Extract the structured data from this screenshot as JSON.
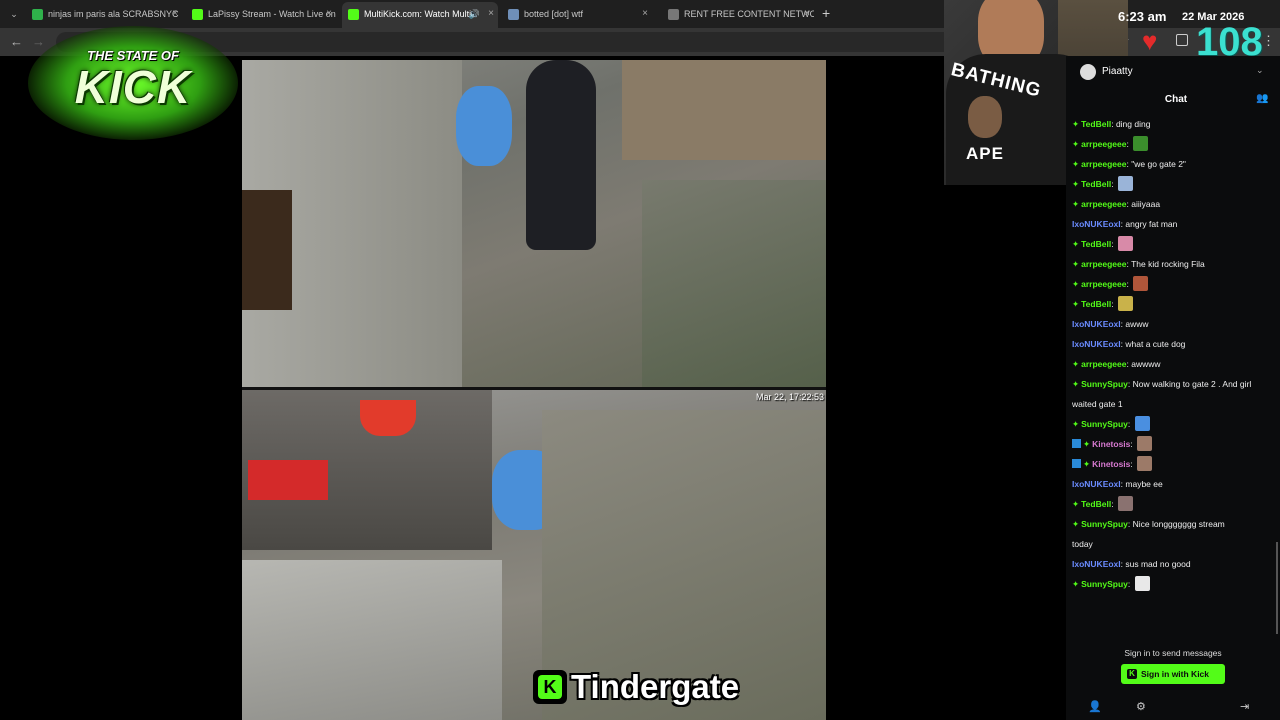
{
  "browser": {
    "tabs": [
      {
        "label": "ninjas im paris ala SCRABSNYC",
        "favicon": "play-icon",
        "active": false
      },
      {
        "label": "LaPissy Stream - Watch Live on",
        "favicon": "kick-icon",
        "active": false
      },
      {
        "label": "MultiKick.com: Watch Multi",
        "favicon": "multikick-icon",
        "active": true
      },
      {
        "label": "botted [dot] wtf",
        "favicon": "globe-icon",
        "active": false
      },
      {
        "label": "RENT FREE CONTENT NETWORK",
        "favicon": "page-icon",
        "active": false
      }
    ],
    "new_tab_glyph": "+",
    "close_glyph": "×"
  },
  "logo": {
    "line1": "THE STATE OF",
    "line2": "KICK"
  },
  "video": {
    "timestamp": "Mar 22, 17:22:53",
    "brand_word": "Tindergate",
    "brand_k": "K"
  },
  "overlay": {
    "time": "6:23 am",
    "date": "22 Mar 2026",
    "counter": "108",
    "shirt_line1": "BATHING",
    "shirt_line2": "APE"
  },
  "chat": {
    "channel_name": "Piaatty",
    "title": "Chat",
    "messages": [
      {
        "user": "TedBell",
        "text": "ding ding",
        "color": "#53fc18",
        "badge": true
      },
      {
        "user": "arrpeegeee",
        "text": "",
        "color": "#53fc18",
        "badge": true,
        "emote": "#3b8e2c"
      },
      {
        "user": "arrpeegeee",
        "text": "\"we go gate 2\"",
        "color": "#53fc18",
        "badge": true
      },
      {
        "user": "TedBell",
        "text": "",
        "color": "#53fc18",
        "badge": true,
        "emote": "#9ab4d8"
      },
      {
        "user": "arrpeegeee",
        "text": "aiiiyaaa",
        "color": "#53fc18",
        "badge": true
      },
      {
        "user": "IxoNUKEoxI",
        "text": "angry fat man",
        "color": "#6b8cff",
        "badge": false
      },
      {
        "user": "TedBell",
        "text": "",
        "color": "#53fc18",
        "badge": true,
        "emote": "#d88aa8"
      },
      {
        "user": "arrpeegeee",
        "text": "The kid rocking Fila",
        "color": "#53fc18",
        "badge": true
      },
      {
        "user": "arrpeegeee",
        "text": "",
        "color": "#53fc18",
        "badge": true,
        "emote": "#b0563a"
      },
      {
        "user": "TedBell",
        "text": "",
        "color": "#53fc18",
        "badge": true,
        "emote": "#c9b24a"
      },
      {
        "user": "IxoNUKEoxI",
        "text": "awww",
        "color": "#6b8cff",
        "badge": false
      },
      {
        "user": "IxoNUKEoxI",
        "text": "what a cute dog",
        "color": "#6b8cff",
        "badge": false
      },
      {
        "user": "arrpeegeee",
        "text": "awwww",
        "color": "#53fc18",
        "badge": true
      },
      {
        "user": "SunnySpuy",
        "text": "Now walking to gate 2 . And girl",
        "color": "#53fc18",
        "badge": true
      },
      {
        "user": "",
        "text": "waited gate 1",
        "color": "#53fc18",
        "badge": false
      },
      {
        "user": "SunnySpuy",
        "text": "",
        "color": "#53fc18",
        "badge": true,
        "emote": "#4a8fe0"
      },
      {
        "user": "Kinetosis",
        "text": "",
        "color": "#d77ad0",
        "badge": true,
        "badge2": true,
        "emote": "#9c7a68"
      },
      {
        "user": "Kinetosis",
        "text": "",
        "color": "#d77ad0",
        "badge": true,
        "badge2": true,
        "emote": "#9c7a68"
      },
      {
        "user": "IxoNUKEoxI",
        "text": "maybe ee",
        "color": "#6b8cff",
        "badge": false
      },
      {
        "user": "TedBell",
        "text": "",
        "color": "#53fc18",
        "badge": true,
        "emote": "#8a7270"
      },
      {
        "user": "SunnySpuy",
        "text": "Nice longgggggg stream",
        "color": "#53fc18",
        "badge": true
      },
      {
        "user": "",
        "text": "today",
        "color": "#53fc18",
        "badge": false
      },
      {
        "user": "IxoNUKEoxI",
        "text": "sus mad no good",
        "color": "#6b8cff",
        "badge": false
      },
      {
        "user": "SunnySpuy",
        "text": "",
        "color": "#53fc18",
        "badge": true,
        "emote": "#e8e8e8"
      }
    ],
    "signin_prompt": "Sign in to send messages",
    "signin_button": "Sign in with Kick"
  },
  "colors": {
    "kick_green": "#53fc18",
    "counter_cyan": "#3be0d0",
    "heart_red": "#e32b2b"
  }
}
